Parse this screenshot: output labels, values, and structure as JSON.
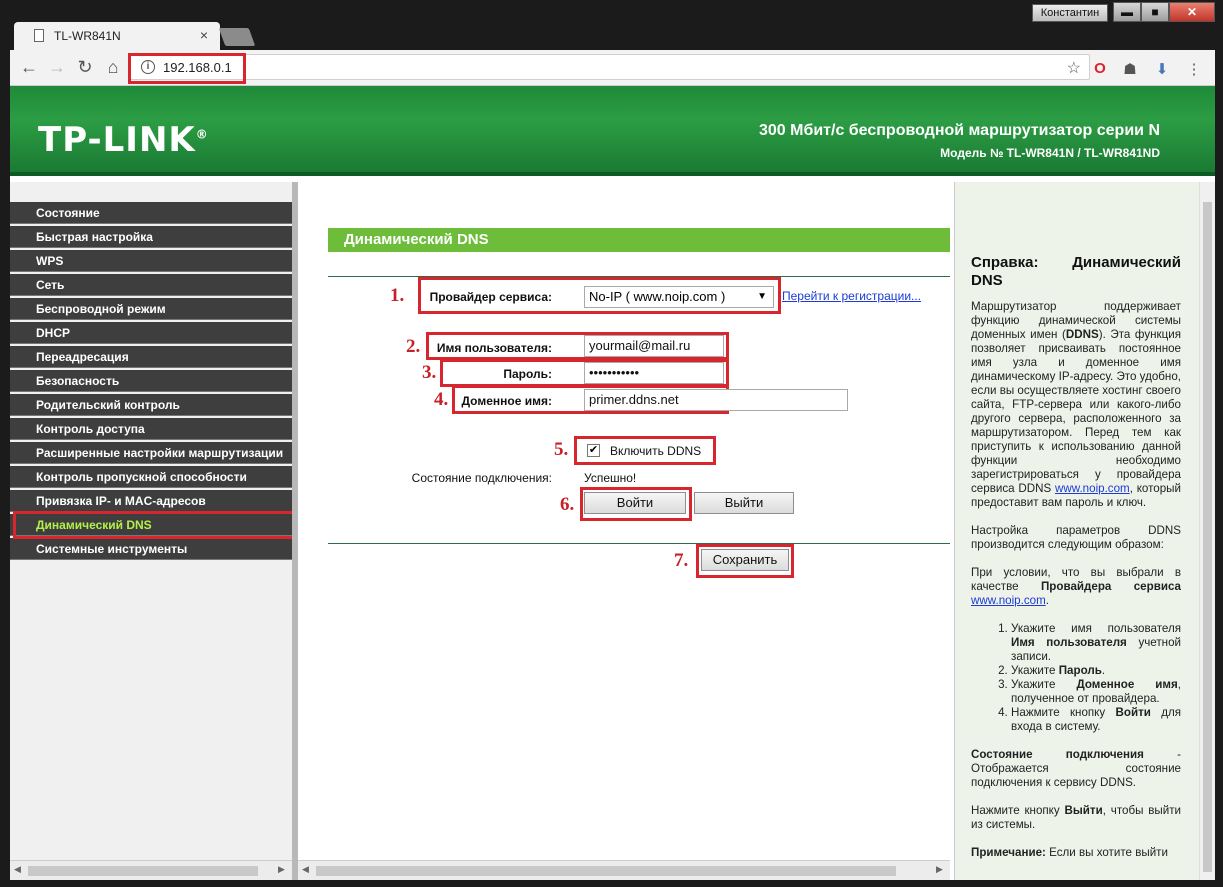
{
  "browser": {
    "tab_title": "TL-WR841N",
    "tab_close": "×",
    "user_name": "Константин",
    "win_min": "▬",
    "win_max": "■",
    "win_close": "✕",
    "back": "←",
    "forward": "→",
    "reload": "↻",
    "home": "⌂",
    "url": "192.168.0.1",
    "info_glyph": "i",
    "star": "☆",
    "menu_glyph": "⋮",
    "ext_opera": "O",
    "ext_mask": "☗",
    "ext_download": "⬇"
  },
  "banner": {
    "logo": "TP-LINK",
    "logo_mark": "®",
    "title": "300 Мбит/с беспроводной маршрутизатор серии N",
    "model": "Модель № TL-WR841N / TL-WR841ND"
  },
  "sidebar": {
    "items": [
      {
        "label": "Состояние"
      },
      {
        "label": "Быстрая настройка"
      },
      {
        "label": "WPS"
      },
      {
        "label": "Сеть"
      },
      {
        "label": "Беспроводной режим"
      },
      {
        "label": "DHCP"
      },
      {
        "label": "Переадресация"
      },
      {
        "label": "Безопасность"
      },
      {
        "label": "Родительский контроль"
      },
      {
        "label": "Контроль доступа"
      },
      {
        "label": "Расширенные настройки маршрутизации"
      },
      {
        "label": "Контроль пропускной способности"
      },
      {
        "label": "Привязка IP- и MAC-адресов"
      },
      {
        "label": "Динамический DNS"
      },
      {
        "label": "Системные инструменты"
      }
    ],
    "active_index": 13
  },
  "form": {
    "header": "Динамический DNS",
    "provider_label": "Провайдер сервиса:",
    "provider_value": "No-IP ( www.noip.com )",
    "register_link": "Перейти к регистрации...",
    "username_label": "Имя пользователя:",
    "username_value": "yourmail@mail.ru",
    "password_label": "Пароль:",
    "password_value": "•••••••••••",
    "domain_label": "Доменное имя:",
    "domain_value": "primer.ddns.net",
    "enable_label": "Включить DDNS",
    "enable_checked": "✔",
    "status_label": "Состояние подключения:",
    "status_value": "Успешно!",
    "login_button": "Войти",
    "logout_button": "Выйти",
    "save_button": "Сохранить"
  },
  "annotations": {
    "n1": "1.",
    "n2": "2.",
    "n3": "3.",
    "n4": "4.",
    "n5": "5.",
    "n6": "6.",
    "n7": "7."
  },
  "help": {
    "title_a": "Справка: Динамический",
    "title_b": "DNS",
    "p1_a": "Маршрутизатор поддерживает функцию динамической системы доменных имен (",
    "p1_b": "DDNS",
    "p1_c": "). Эта функция позволяет присваивать постоянное имя узла и доменное имя динамическому IP-адресу. Это удобно, если вы осуществляете хостинг своего сайта, FTP-сервера или какого-либо другого сервера, расположенного за маршрутизатором. Перед тем как приступить к использованию данной функции необходимо зарегистрироваться у провайдера сервиса DDNS ",
    "p1_link": "www.noip.com",
    "p1_d": ", который предоставит вам пароль и ключ.",
    "p2": "Настройка параметров DDNS производится следующим образом:",
    "p3_a": "При условии, что вы выбрали в качестве ",
    "p3_b": "Провайдера сервиса",
    "p3_link": "www.noip.com",
    "p3_end": ".",
    "li1_a": "Укажите имя пользователя ",
    "li1_b": "Имя пользователя",
    "li1_c": " учетной записи.",
    "li2_a": "Укажите ",
    "li2_b": "Пароль",
    "li2_c": ".",
    "li3_a": "Укажите ",
    "li3_b": "Доменное имя",
    "li3_c": ", полученное от провайдера.",
    "li4_a": "Нажмите кнопку ",
    "li4_b": "Войти",
    "li4_c": " для входа в систему.",
    "p4_a": "Состояние подключения",
    "p4_b": " - Отображается состояние подключения к сервису DDNS.",
    "p5_a": "Нажмите кнопку ",
    "p5_b": "Выйти",
    "p5_c": ", чтобы выйти из системы.",
    "p6_a": "Примечание:",
    "p6_b": " Если вы хотите выйти"
  },
  "colors": {
    "accent_green": "#6dbd3a",
    "annotation_red": "#d7262d",
    "active_menu_text": "#b4f04a"
  }
}
